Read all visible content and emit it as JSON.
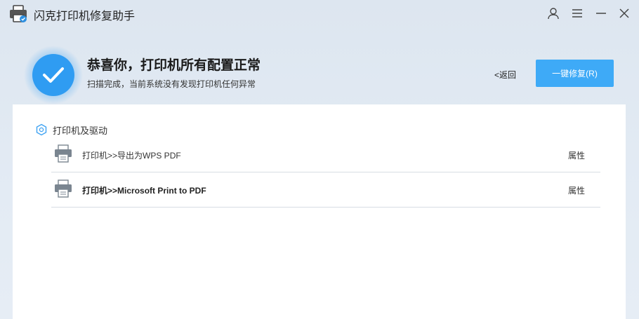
{
  "window": {
    "title": "闪克打印机修复助手",
    "controls": {
      "user_icon": "user-icon",
      "menu_icon": "menu-icon",
      "minimize_icon": "minimize-icon",
      "close_icon": "close-icon"
    }
  },
  "header": {
    "status_icon": "check-circle-icon",
    "headline": "恭喜你，打印机所有配置正常",
    "subline": "扫描完成，当前系统没有发现打印机任何异常",
    "back_label": "<返回",
    "repair_button_label": "一键修复(R)"
  },
  "section": {
    "icon": "hexagon-icon",
    "title": "打印机及驱动",
    "printers": [
      {
        "name": "打印机>>导出为WPS PDF",
        "property_label": "属性",
        "icon": "printer-icon"
      },
      {
        "name": "打印机>>Microsoft Print to PDF",
        "property_label": "属性",
        "icon": "printer-icon"
      }
    ]
  },
  "colors": {
    "accent": "#3eaaf7",
    "background": "#e3ebf4",
    "panel": "#ffffff"
  }
}
